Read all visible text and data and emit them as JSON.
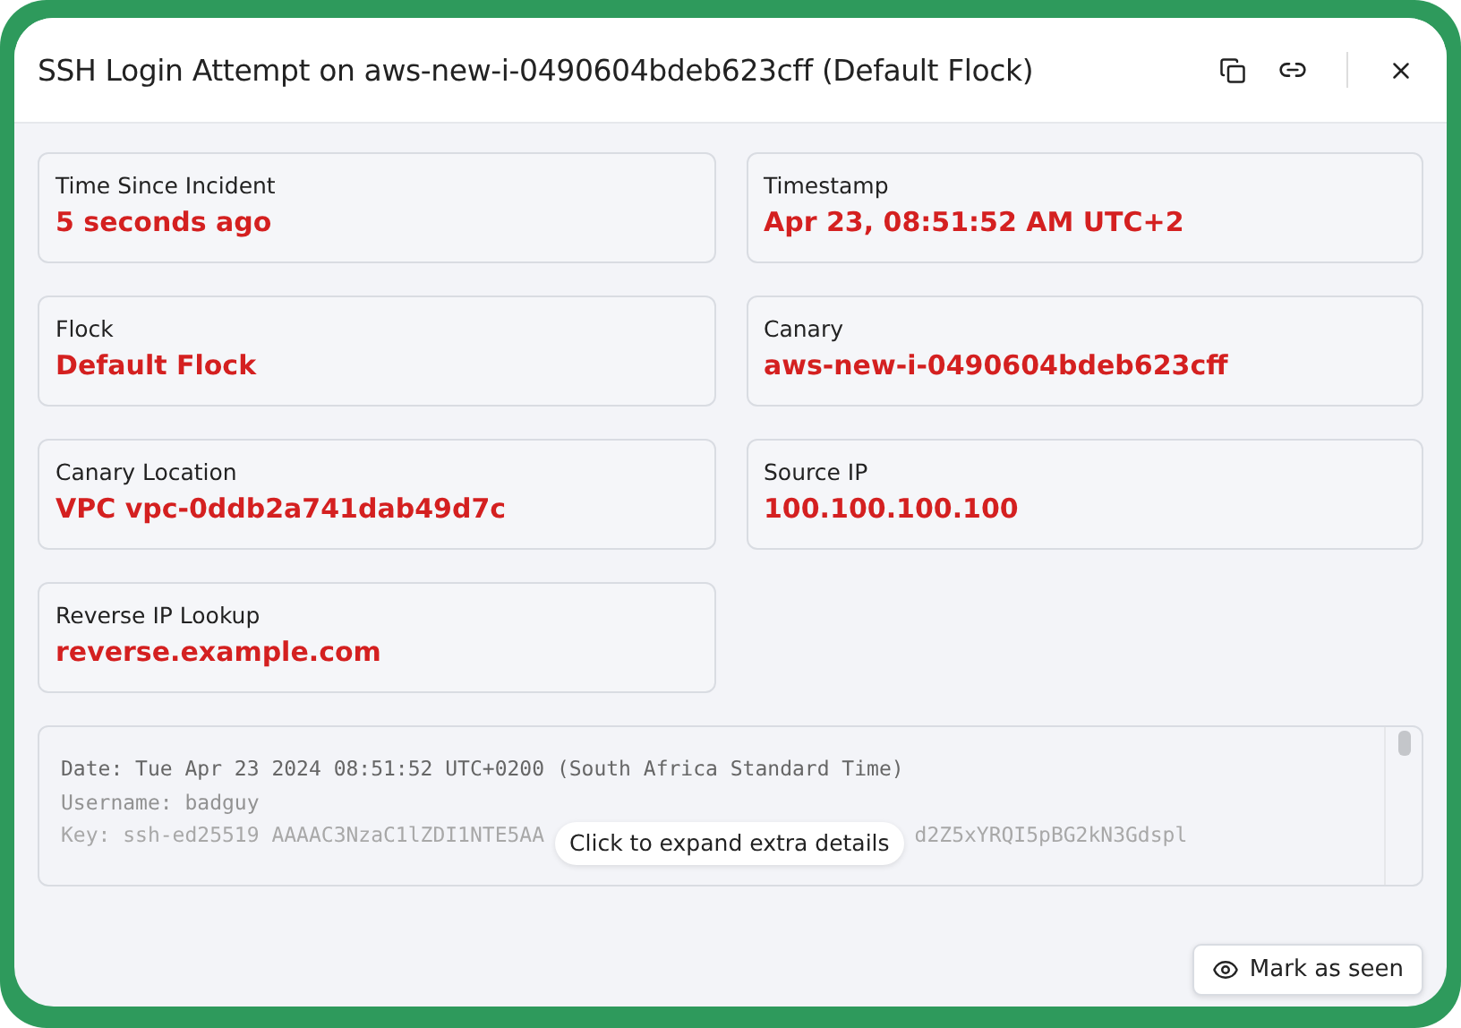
{
  "window": {
    "title": "SSH Login Attempt on aws-new-i-0490604bdeb623cff (Default Flock)"
  },
  "fields": [
    {
      "label": "Time Since Incident",
      "value": "5 seconds ago"
    },
    {
      "label": "Timestamp",
      "value": "Apr 23, 08:51:52 AM UTC+2"
    },
    {
      "label": "Flock",
      "value": "Default Flock"
    },
    {
      "label": "Canary",
      "value": "aws-new-i-0490604bdeb623cff"
    },
    {
      "label": "Canary Location",
      "value": "VPC vpc-0ddb2a741dab49d7c"
    },
    {
      "label": "Source IP",
      "value": "100.100.100.100"
    },
    {
      "label": "Reverse IP Lookup",
      "value": "reverse.example.com"
    }
  ],
  "details": {
    "lines": [
      "Date: Tue Apr 23 2024 08:51:52 UTC+0200 (South Africa Standard Time)",
      "Username: badguy"
    ],
    "last_line_parts": [
      "Key: ssh-ed25519 AAAAC3NzaC1lZDI1NTE5AA",
      "d2Z5xYRQI5pBG2kN3Gdspl"
    ],
    "tooltip": "Click to expand extra details"
  },
  "buttons": [
    {
      "label": "Mark as seen"
    }
  ]
}
